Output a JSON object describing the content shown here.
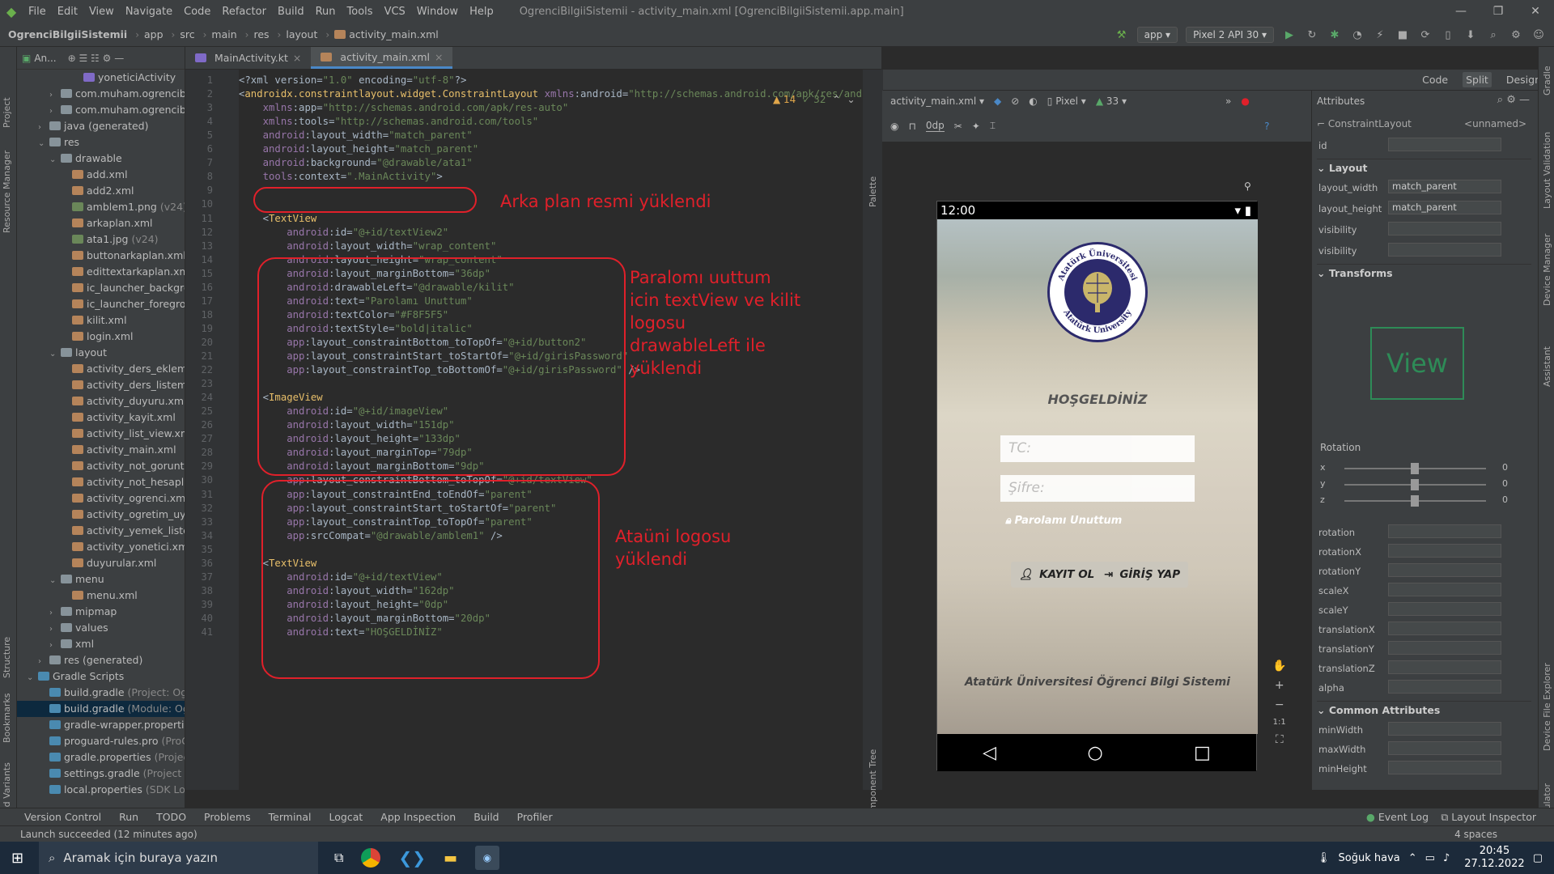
{
  "window": {
    "title": "OgrenciBilgiiSistemii - activity_main.xml [OgrenciBilgiiSistemii.app.main]",
    "menu": [
      "File",
      "Edit",
      "View",
      "Navigate",
      "Code",
      "Refactor",
      "Build",
      "Run",
      "Tools",
      "VCS",
      "Window",
      "Help"
    ]
  },
  "nav": {
    "breadcrumbs": [
      "OgrenciBilgiiSistemii",
      "app",
      "src",
      "main",
      "res",
      "layout",
      "activity_main.xml"
    ],
    "run_config": "app",
    "device": "Pixel 2 API 30"
  },
  "project": {
    "header": "An...",
    "items": [
      {
        "label": "yoneticiActivity",
        "indent": 3,
        "icon": "kt"
      },
      {
        "label": "com.muham.ogrencibilgiisist",
        "indent": 1,
        "icon": "fold",
        "tw": "›"
      },
      {
        "label": "com.muham.ogrencibilgiisist",
        "indent": 1,
        "icon": "fold",
        "tw": "›"
      },
      {
        "label": "java (generated)",
        "indent": 0,
        "icon": "fold",
        "tw": "›"
      },
      {
        "label": "res",
        "indent": 0,
        "icon": "fold",
        "tw": "⌄"
      },
      {
        "label": "drawable",
        "indent": 1,
        "icon": "fold",
        "tw": "⌄"
      },
      {
        "label": "add.xml",
        "indent": 2,
        "icon": "xml"
      },
      {
        "label": "add2.xml",
        "indent": 2,
        "icon": "xml"
      },
      {
        "label": "amblem1.png",
        "dim": "(v24)",
        "indent": 2,
        "icon": "png"
      },
      {
        "label": "arkaplan.xml",
        "indent": 2,
        "icon": "xml"
      },
      {
        "label": "ata1.jpg",
        "dim": "(v24)",
        "indent": 2,
        "icon": "png"
      },
      {
        "label": "buttonarkaplan.xml",
        "indent": 2,
        "icon": "xml"
      },
      {
        "label": "edittextarkaplan.xml",
        "indent": 2,
        "icon": "xml"
      },
      {
        "label": "ic_launcher_background.x",
        "indent": 2,
        "icon": "xml"
      },
      {
        "label": "ic_launcher_foreground.x",
        "indent": 2,
        "icon": "xml"
      },
      {
        "label": "kilit.xml",
        "indent": 2,
        "icon": "xml"
      },
      {
        "label": "login.xml",
        "indent": 2,
        "icon": "xml"
      },
      {
        "label": "layout",
        "indent": 1,
        "icon": "fold",
        "tw": "⌄"
      },
      {
        "label": "activity_ders_ekleme.xml",
        "indent": 2,
        "icon": "xml"
      },
      {
        "label": "activity_ders_listeme.xml",
        "indent": 2,
        "icon": "xml"
      },
      {
        "label": "activity_duyuru.xml",
        "indent": 2,
        "icon": "xml"
      },
      {
        "label": "activity_kayit.xml",
        "indent": 2,
        "icon": "xml"
      },
      {
        "label": "activity_list_view.xml",
        "indent": 2,
        "icon": "xml"
      },
      {
        "label": "activity_main.xml",
        "indent": 2,
        "icon": "xml"
      },
      {
        "label": "activity_not_goruntuleme",
        "indent": 2,
        "icon": "xml"
      },
      {
        "label": "activity_not_hesaplama.xr",
        "indent": 2,
        "icon": "xml"
      },
      {
        "label": "activity_ogrenci.xml",
        "indent": 2,
        "icon": "xml"
      },
      {
        "label": "activity_ogretim_uyesi.xm",
        "indent": 2,
        "icon": "xml"
      },
      {
        "label": "activity_yemek_listesi.xml",
        "indent": 2,
        "icon": "xml"
      },
      {
        "label": "activity_yonetici.xml",
        "indent": 2,
        "icon": "xml"
      },
      {
        "label": "duyurular.xml",
        "indent": 2,
        "icon": "xml"
      },
      {
        "label": "menu",
        "indent": 1,
        "icon": "fold",
        "tw": "⌄"
      },
      {
        "label": "menu.xml",
        "indent": 2,
        "icon": "xml"
      },
      {
        "label": "mipmap",
        "indent": 1,
        "icon": "fold",
        "tw": "›"
      },
      {
        "label": "values",
        "indent": 1,
        "icon": "fold",
        "tw": "›"
      },
      {
        "label": "xml",
        "indent": 1,
        "icon": "fold",
        "tw": "›"
      },
      {
        "label": "res (generated)",
        "indent": 0,
        "icon": "fold",
        "tw": "›"
      },
      {
        "label": "Gradle Scripts",
        "indent": -1,
        "icon": "grd",
        "tw": "⌄"
      },
      {
        "label": "build.gradle",
        "dim": "(Project: OgrenciBilg",
        "indent": 0,
        "icon": "grd"
      },
      {
        "label": "build.gradle",
        "dim": "(Module: OgrenciBil",
        "indent": 0,
        "icon": "grd",
        "sel": true
      },
      {
        "label": "gradle-wrapper.properties",
        "dim": "(Gradl",
        "indent": 0,
        "icon": "grd"
      },
      {
        "label": "proguard-rules.pro",
        "dim": "(ProGuard Ru",
        "indent": 0,
        "icon": "grd"
      },
      {
        "label": "gradle.properties",
        "dim": "(Project Proper",
        "indent": 0,
        "icon": "grd"
      },
      {
        "label": "settings.gradle",
        "dim": "(Project Settings)",
        "indent": 0,
        "icon": "grd"
      },
      {
        "label": "local.properties",
        "dim": "(SDK Location)",
        "indent": 0,
        "icon": "grd"
      }
    ]
  },
  "editor": {
    "tabs": [
      {
        "label": "MainActivity.kt"
      },
      {
        "label": "activity_main.xml"
      }
    ],
    "warnings": "▲ 14",
    "checks": "✓ 32",
    "lines": [
      "<?xml version=\"1.0\" encoding=\"utf-8\"?>",
      "<androidx.constraintlayout.widget.ConstraintLayout xmlns:android=\"http://schemas.android.com/apk/res/android\"",
      "    xmlns:app=\"http://schemas.android.com/apk/res-auto\"",
      "    xmlns:tools=\"http://schemas.android.com/tools\"",
      "    android:layout_width=\"match_parent\"",
      "    android:layout_height=\"match_parent\"",
      "    android:background=\"@drawable/ata1\"",
      "    tools:context=\".MainActivity\">",
      "",
      "",
      "    <TextView",
      "        android:id=\"@+id/textView2\"",
      "        android:layout_width=\"wrap_content\"",
      "        android:layout_height=\"wrap_content\"",
      "        android:layout_marginBottom=\"36dp\"",
      "        android:drawableLeft=\"@drawable/kilit\"",
      "        android:text=\"Parolamı Unuttum\"",
      "        android:textColor=\"#F8F5F5\"",
      "        android:textStyle=\"bold|italic\"",
      "        app:layout_constraintBottom_toTopOf=\"@+id/button2\"",
      "        app:layout_constraintStart_toStartOf=\"@+id/girisPassword\"",
      "        app:layout_constraintTop_toBottomOf=\"@+id/girisPassword\" />",
      "",
      "    <ImageView",
      "        android:id=\"@+id/imageView\"",
      "        android:layout_width=\"151dp\"",
      "        android:layout_height=\"133dp\"",
      "        android:layout_marginTop=\"79dp\"",
      "        android:layout_marginBottom=\"9dp\"",
      "        app:layout_constraintBottom_toTopOf=\"@+id/textView\"",
      "        app:layout_constraintEnd_toEndOf=\"parent\"",
      "        app:layout_constraintStart_toStartOf=\"parent\"",
      "        app:layout_constraintTop_toTopOf=\"parent\"",
      "        app:srcCompat=\"@drawable/amblem1\" />",
      "",
      "    <TextView",
      "        android:id=\"@+id/textView\"",
      "        android:layout_width=\"162dp\"",
      "        android:layout_height=\"0dp\"",
      "        android:layout_marginBottom=\"20dp\"",
      "        android:text=\"HOŞGELDİNİZ\""
    ]
  },
  "annotations": {
    "bg": "Arka plan resmi yüklendi",
    "forgot": "Paralomı uuttum\nicin textView ve kilit\nlogosu\ndrawableLeft ile\nyüklendi",
    "logo": "Ataüni logosu\nyüklendi"
  },
  "design": {
    "file": "activity_main.xml",
    "device": "Pixel",
    "api": "33",
    "dp": "0dp",
    "modes": [
      "Code",
      "Split",
      "Design"
    ]
  },
  "phone": {
    "time": "12:00",
    "welcome": "HOŞGELDİNİZ",
    "tc_placeholder": "TC:",
    "pass_placeholder": "Şifre:",
    "forgot": "Parolamı Unuttum",
    "register": "KAYIT OL",
    "login": "GİRİŞ YAP",
    "footer": "Atatürk Üniversitesi Öğrenci Bilgi Sistemi",
    "logo_top": "Atatürk Üniversitesi",
    "logo_bottom": "Atatürk University"
  },
  "attributes": {
    "title": "Attributes",
    "class": "ConstraintLayout",
    "unnamed": "<unnamed>",
    "id": "id",
    "layout": "Layout",
    "layout_width": "layout_width",
    "layout_width_val": "match_parent",
    "layout_height": "layout_height",
    "layout_height_val": "match_parent",
    "visibility": "visibility",
    "visibility2": "visibility",
    "transforms": "Transforms",
    "preview": "View",
    "rotation_label": "Rotation",
    "x": "x",
    "y": "y",
    "z": "z",
    "zero": "0",
    "rows": [
      "rotation",
      "rotationX",
      "rotationY",
      "scaleX",
      "scaleY",
      "translationX",
      "translationY",
      "translationZ",
      "alpha"
    ],
    "common": "Common Attributes",
    "crows": [
      "minWidth",
      "maxWidth",
      "minHeight"
    ]
  },
  "bottom_tools": [
    "Version Control",
    "Run",
    "TODO",
    "Problems",
    "Terminal",
    "Logcat",
    "App Inspection",
    "Build",
    "Profiler"
  ],
  "bottom_right": [
    "Event Log",
    "Layout Inspector"
  ],
  "status": {
    "msg": "Launch succeeded (12 minutes ago)",
    "indent": "4 spaces"
  },
  "taskbar": {
    "search": "Aramak için buraya yazın",
    "weather": "Soğuk hava",
    "time": "20:45",
    "date": "27.12.2022"
  },
  "colors": {
    "annotation": "#e0202a",
    "accent": "#4a88c7"
  }
}
